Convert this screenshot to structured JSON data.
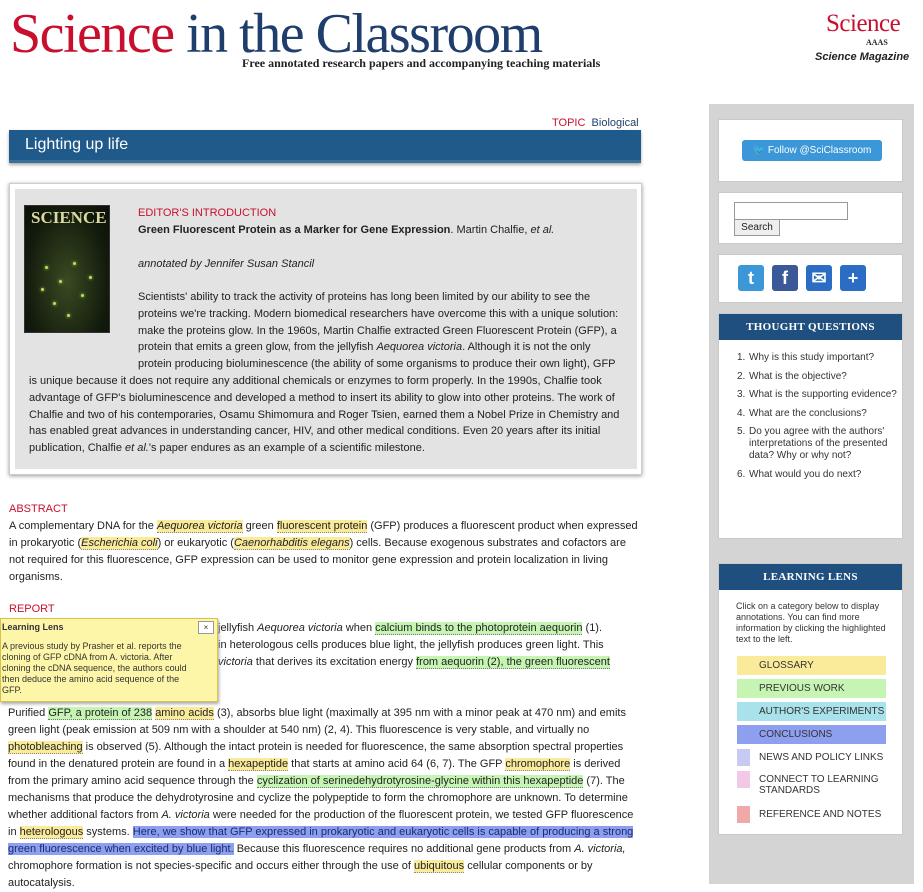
{
  "header": {
    "logo_part1": "Science",
    "logo_part2": " in the Classroom",
    "tagline": "Free annotated research papers and accompanying teaching materials",
    "science_logo": "Science",
    "science_logo_sub": "AAAS",
    "science_magazine": "Science Magazine"
  },
  "topic": {
    "label": "TOPIC",
    "value": "Biological"
  },
  "page_title": "Lighting up life",
  "editor_intro": {
    "label": "EDITOR'S INTRODUCTION",
    "paper_title": "Green Fluorescent Protein as a Marker for Gene Expression",
    "authors_prefix": ". Martin Chalfie, ",
    "authors_etal": "et al.",
    "annotated_by": "annotated by Jennifer Susan Stancil",
    "cover_title": "SCIENCE",
    "body_a": "Scientists' ability to track the activity of proteins has long been limited by our ability to see the proteins we're tracking. Modern biomedical researchers have overcome this with a unique solution: make the proteins glow. In the 1960s, Martin Chalfie extracted Green Fluorescent Protein (GFP), a protein that emits a green glow, from the jellyfish ",
    "body_species": "Aequorea victoria",
    "body_b": ". Although it is not the only protein producing bioluminescence (the ability of some organisms to produce their own light), GFP is unique because it does not require any additional chemicals or enzymes to form properly. In the 1990s, Chalfie took advantage of GFP's bioluminescence and developed a method to insert its ability to glow into other proteins. The work of Chalfie and two of his contemporaries, Osamu Shimomura and Roger Tsien, earned them a Nobel Prize in Chemistry and has enabled great advances in understanding cancer, HIV, and other medical conditions. Even 20 years after its initial publication, Chalfie ",
    "body_etal": "et al.",
    "body_c": "'s paper endures as an example of a scientific milestone."
  },
  "abstract": {
    "heading": "ABSTRACT",
    "t1": "A complementary DNA for the ",
    "g1": "Aequorea victoria",
    "t2": " green ",
    "g2": "fluorescent protein",
    "t3": " (GFP) produces a fluorescent product when expressed in prokaryotic (",
    "g3": "Escherichia coli",
    "t4": ") or eukaryotic (",
    "g4": "Caenorhabditis elegans",
    "t5": ") cells. Because exogenous substrates and cofactors are not required for this fluorescence, GFP expression can be used to monitor gene expression and protein localization in living organisms."
  },
  "report": {
    "heading": "REPORT",
    "p1_t1": "jellyfish ",
    "p1_i1": "Aequorea victoria",
    "p1_t2": " when ",
    "p1_pw1": "calcium binds to the photoprotein aequorin",
    "p1_t3": " (1).",
    "p1_t4": "in heterologous cells produces blue light, the jellyfish produces green light. This",
    "p1_i2": "victoria",
    "p1_t5": " that derives its excitation energy ",
    "p1_pw2": "from aequorin (2), the green fluorescent",
    "p2_t1": "Purified ",
    "p2_pw1": "GFP, a protein of 238",
    "p2_t2": " ",
    "p2_g1": "amino acids",
    "p2_t3": " (3), absorbs blue light (maximally at 395 nm with a minor peak at 470 nm) and emits green light (peak emission at 509 nm with a shoulder at 540 nm) (2, 4). This fluorescence is very stable, and virtually no ",
    "p2_g2": "photobleaching",
    "p2_t4": " is observed (5). Although the intact protein is needed for fluorescence, the same absorption spectral properties found in the denatured protein are found in a ",
    "p2_g3": "hexapeptide",
    "p2_t5": " that starts at amino acid 64 (6, 7). The GFP ",
    "p2_g4": "chromophore",
    "p2_t6": " is derived from the primary amino acid sequence through the ",
    "p2_pw2": "cyclization of serinedehydrotyrosine-glycine within this hexapeptide",
    "p2_t7": " (7). The mechanisms that produce the dehydrotyrosine and cyclize the polypeptide to form the chromophore are unknown. To determine whether additional factors from ",
    "p2_i1": "A. victoria",
    "p2_t8": " were needed for the production of the fluorescent protein, we tested GFP fluorescence in ",
    "p2_g5": "heterologous",
    "p2_t9": " systems. ",
    "p2_ae": "Here, we show that GFP expressed in prokaryotic and eukaryotic cells is capable of producing a strong green fluorescence when excited by blue light.",
    "p2_t10": " Because this fluorescence requires no additional gene products from ",
    "p2_i2": "A. victoria,",
    "p2_t11": " chromophore formation is not species-specific and occurs either through the use of ",
    "p2_g6": "ubiquitous",
    "p2_t12": " cellular components or by autocatalysis."
  },
  "tooltip": {
    "title": "Learning Lens",
    "close": "×",
    "text": "A previous study by Prasher et al. reports the cloning of GFP cDNA from A. victoria. After cloning the cDNA sequence, the authors could then deduce the amino acid sequence of the GFP."
  },
  "sidebar": {
    "follow_label": "Follow @SciClassroom",
    "search_value": "",
    "search_button": "Search",
    "share": [
      {
        "name": "twitter-share-icon",
        "glyph": "t",
        "color": "#3b97d8"
      },
      {
        "name": "facebook-share-icon",
        "glyph": "f",
        "color": "#3b5998"
      },
      {
        "name": "email-share-icon",
        "glyph": "✉",
        "color": "#2b6cc4"
      },
      {
        "name": "more-share-icon",
        "glyph": "+",
        "color": "#2b6cc4"
      }
    ],
    "thought_title": "THOUGHT QUESTIONS",
    "questions": [
      "Why is this study important?",
      "What is the objective?",
      "What is the supporting evidence?",
      "What are the conclusions?",
      "Do you agree with the authors' interpretations of the presented data? Why or why not?",
      "What would you do next?"
    ],
    "lens_title": "LEARNING LENS",
    "lens_intro": "Click on a category below to display annotations. You can find more information by clicking the highlighted text to the left.",
    "lens_active": [
      {
        "label": "GLOSSARY",
        "color": "#faeb9b"
      },
      {
        "label": "PREVIOUS WORK",
        "color": "#c6f5b3"
      },
      {
        "label": "AUTHOR'S EXPERIMENTS",
        "color": "#a9e2ea"
      },
      {
        "label": "CONCLUSIONS",
        "color": "#8f9ff0"
      }
    ],
    "lens_inactive": [
      {
        "label": "NEWS AND POLICY LINKS",
        "color": "#c9caf3"
      },
      {
        "label": "CONNECT TO LEARNING STANDARDS",
        "color": "#f2c8e6"
      },
      {
        "label": "REFERENCE AND NOTES",
        "color": "#f0a8a8"
      }
    ]
  }
}
